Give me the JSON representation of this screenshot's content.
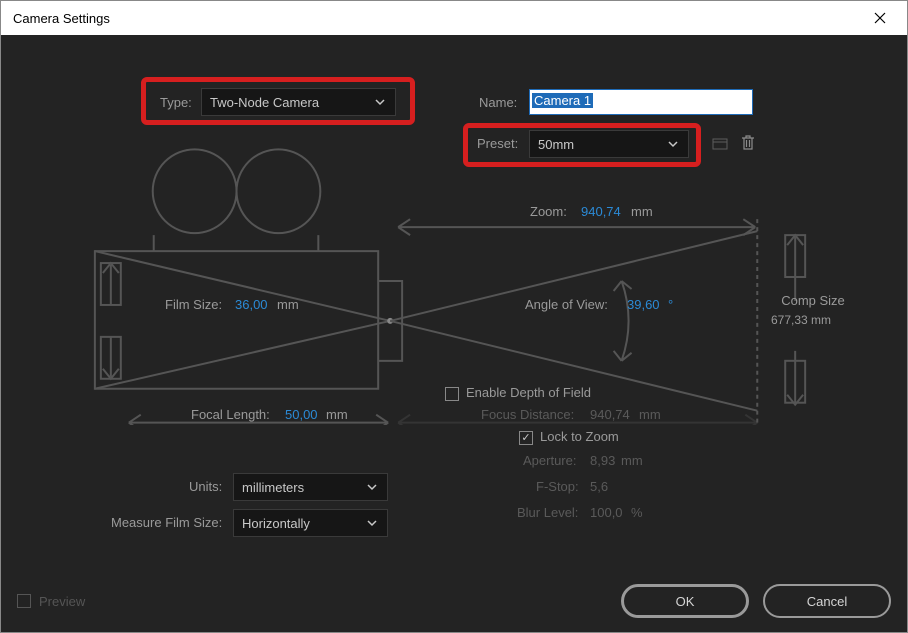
{
  "window": {
    "title": "Camera Settings"
  },
  "type": {
    "label": "Type:",
    "value": "Two-Node Camera"
  },
  "name": {
    "label": "Name:",
    "value": "Camera 1"
  },
  "preset": {
    "label": "Preset:",
    "value": "50mm"
  },
  "diagram": {
    "zoom": {
      "label": "Zoom:",
      "value": "940,74",
      "unit": "mm"
    },
    "film_size": {
      "label": "Film Size:",
      "value": "36,00",
      "unit": "mm"
    },
    "angle": {
      "label": "Angle of View:",
      "value": "39,60",
      "unit": "°"
    },
    "comp_size": {
      "label": "Comp Size",
      "value": "677,33 mm"
    },
    "focal_length": {
      "label": "Focal Length:",
      "value": "50,00",
      "unit": "mm"
    },
    "focus_distance": {
      "label": "Focus Distance:",
      "value": "940,74",
      "unit": "mm"
    }
  },
  "depth": {
    "enable": {
      "label": "Enable Depth of Field",
      "checked": false
    },
    "lock": {
      "label": "Lock to Zoom",
      "checked": true
    },
    "aperture": {
      "label": "Aperture:",
      "value": "8,93",
      "unit": "mm"
    },
    "fstop": {
      "label": "F-Stop:",
      "value": "5,6"
    },
    "blur": {
      "label": "Blur Level:",
      "value": "100,0",
      "unit": "%"
    }
  },
  "units": {
    "label": "Units:",
    "value": "millimeters"
  },
  "measure": {
    "label": "Measure Film Size:",
    "value": "Horizontally"
  },
  "footer": {
    "preview": "Preview",
    "ok": "OK",
    "cancel": "Cancel"
  }
}
